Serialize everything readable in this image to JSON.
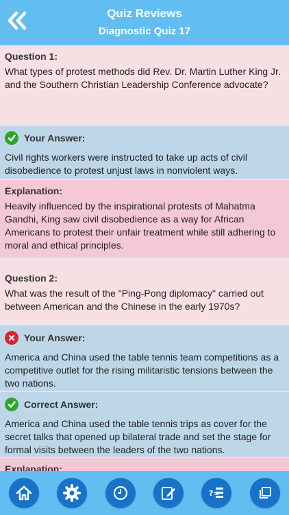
{
  "header": {
    "title": "Quiz Reviews",
    "subtitle": "Diagnostic Quiz 17"
  },
  "questions": [
    {
      "label": "Question 1:",
      "text": "What types of protest methods did Rev. Dr. Martin Luther King Jr. and the Southern Christian Leadership Conference advocate?",
      "your_answer_label": "Your Answer:",
      "your_answer_status": "correct",
      "your_answer_text": "Civil rights workers were instructed to take up acts of civil disobedience to protest unjust laws in nonviolent ways.",
      "explanation_label": "Explanation:",
      "explanation_text": "Heavily influenced by the inspirational protests of Mahatma Gandhi, King saw civil disobedience as a way for African Americans to protest their unfair treatment while still adhering to moral and ethical principles."
    },
    {
      "label": "Question 2:",
      "text": "What was the result of the \"Ping-Pong diplomacy\" carried out between American and the Chinese in the early 1970s?",
      "your_answer_label": "Your Answer:",
      "your_answer_status": "incorrect",
      "your_answer_text": "America and China used the table tennis team competitions as a competitive outlet for the rising militaristic tensions between the two nations.",
      "correct_answer_label": "Correct Answer:",
      "correct_answer_text": "America and China used the table tennis trips as cover for the secret talks that opened up bilateral trade and set the stage for formal visits between the leaders of the two nations.",
      "explanation_label": "Explanation:"
    }
  ],
  "colors": {
    "header": "#62bdf0",
    "question_bg": "#f7e0e4",
    "answer_bg": "#bdd7e9",
    "explanation_bg": "#f5c8d6",
    "correct": "#2fa52f",
    "incorrect": "#d9252a",
    "tab_icon": "#1773c9"
  },
  "tabbar": {
    "items": [
      "home-icon",
      "gear-icon",
      "clock-icon",
      "edit-icon",
      "quiz-list-icon",
      "copy-icon"
    ]
  }
}
